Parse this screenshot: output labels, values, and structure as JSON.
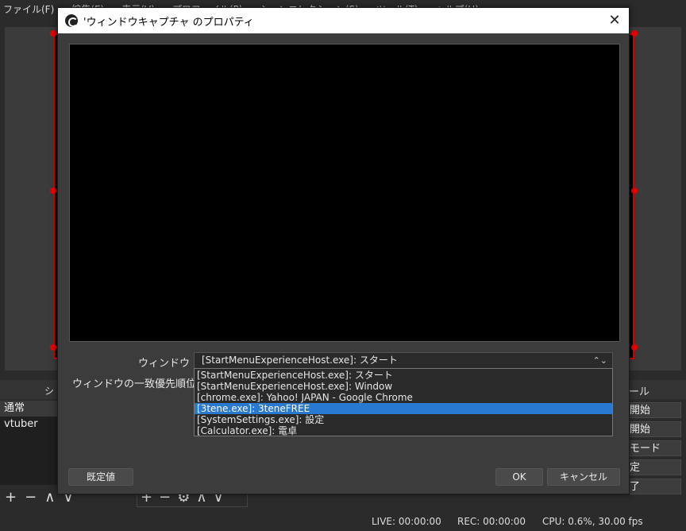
{
  "main_window": {
    "menubar": [
      "ファイル(F)",
      "編集(E)",
      "表示(V)",
      "プロファイル(P)",
      "シーンコレクション(S)",
      "ツール(T)",
      "ヘルプ(H)"
    ],
    "scenes_header": "シ",
    "scenes": [
      "通常",
      "vtuber"
    ],
    "controls_header": "ール",
    "controls": [
      "開始",
      "開始",
      "モード",
      "定",
      "了"
    ],
    "toolbar_glyphs": {
      "add": "+",
      "remove": "−",
      "up": "∧",
      "down": "∨",
      "settings": "⚙"
    },
    "status": {
      "live": "LIVE: 00:00:00",
      "rec": "REC: 00:00:00",
      "cpu": "CPU: 0.6%, 30.00 fps"
    }
  },
  "dialog": {
    "title": "'ウィンドウキャプチャ のプロパティ",
    "close_glyph": "✕",
    "window_label": "ウィンドウ",
    "priority_label": "ウィンドウの一致優先順位",
    "window_select": {
      "value": "[StartMenuExperienceHost.exe]: スタート",
      "arrow_glyph": "⌃⌄"
    },
    "window_options": [
      "[StartMenuExperienceHost.exe]: スタート",
      "[StartMenuExperienceHost.exe]: Window",
      "[chrome.exe]: Yahoo! JAPAN - Google Chrome",
      "[3tene.exe]: 3teneFREE",
      "[SystemSettings.exe]: 設定",
      "[Calculator.exe]: 電卓"
    ],
    "highlighted_option_index": 3,
    "buttons": {
      "defaults": "既定値",
      "ok": "OK",
      "cancel": "キャンセル"
    }
  },
  "colors": {
    "selection": "#2a79d0",
    "canvas_border": "#dd0000",
    "dialog_bg": "#3c3c3c"
  }
}
